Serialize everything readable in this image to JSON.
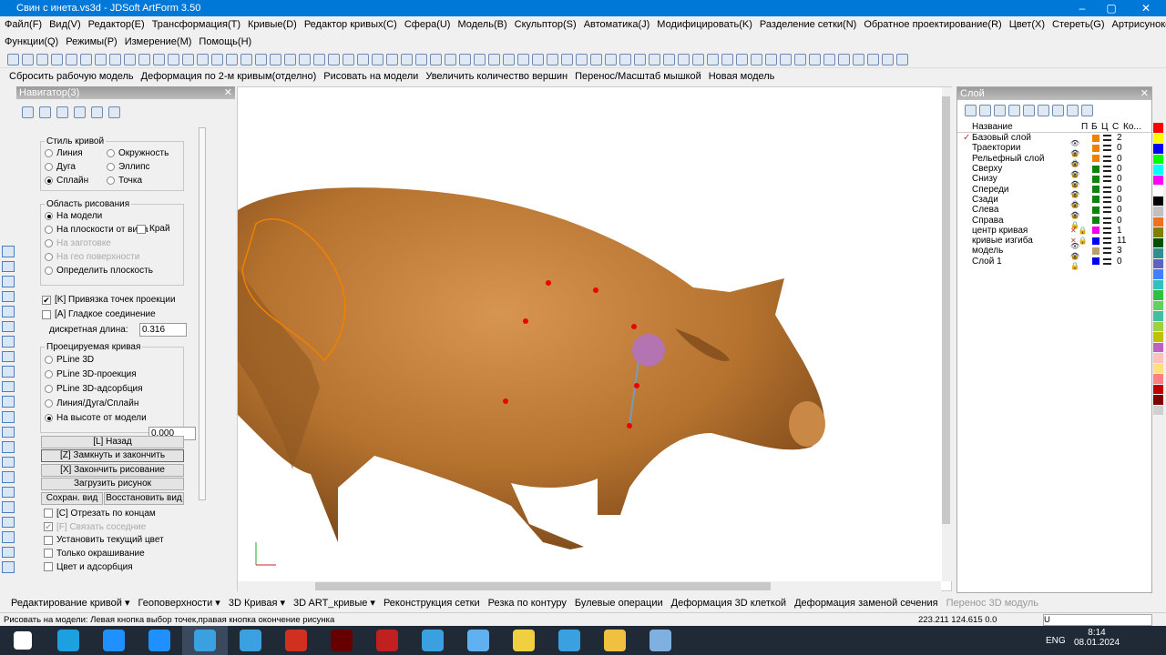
{
  "window": {
    "title": "Свин с инета.vs3d - JDSoft ArtForm 3.50",
    "min": "–",
    "max": "▢",
    "close": "✕"
  },
  "menu_row1": [
    "Файл(F)",
    "Вид(V)",
    "Редактор(E)",
    "Трансформация(T)",
    "Кривые(D)",
    "Редактор кривых(C)",
    "Сфера(U)",
    "Модель(B)",
    "Скульптор(S)",
    "Автоматика(J)",
    "Модифицировать(K)",
    "Разделение сетки(N)",
    "Обратное проектирование(R)",
    "Цвет(X)",
    "Стереть(G)",
    "Артрисунок(Y)"
  ],
  "menu_row2": [
    "Функции(Q)",
    "Режимы(P)",
    "Измерение(M)",
    "Помощь(H)"
  ],
  "text_toolbar": [
    "Сбросить рабочую модель",
    "Деформация по 2-м кривым(отделно)",
    "Рисовать на модели",
    "Увеличить количество вершин",
    "Перенос/Масштаб мышкой",
    "Новая модель"
  ],
  "navigator": {
    "title": "Навигатор(3)",
    "curve_style": {
      "label": "Стиль кривой",
      "options": [
        "Линия",
        "Окружность",
        "Дуга",
        "Эллипс",
        "Сплайн",
        "Точка"
      ],
      "selected": "Сплайн"
    },
    "draw_area": {
      "label": "Область рисования",
      "options": [
        "На модели",
        "На  плоскости от вида",
        "На заготовке",
        "На гео поверхности",
        "Определить плоскость"
      ],
      "selected": "На модели",
      "edge_label": "Край",
      "edge_checked": false
    },
    "snap_label": "[K] Привязка точек проекции",
    "snap_checked": true,
    "smooth_label": "[A] Гладкое соединение",
    "smooth_checked": false,
    "discrete_label": "дискретная длина:",
    "discrete_value": "0.316",
    "projected": {
      "label": "Проецируемая кривая",
      "options": [
        "PLine 3D",
        "PLine 3D-проекция",
        "PLine 3D-адсорбция",
        "Линия/Дуга/Сплайн",
        "На высоте от модели"
      ],
      "selected": "На высоте от модели",
      "height_value": "0.000"
    },
    "buttons": {
      "back": "[L] Назад",
      "close_finish": "[Z] Замкнуть и закончить",
      "finish": "[X] Закончить рисование",
      "load": "Загрузить рисунок",
      "save_view": "Сохран. вид",
      "restore_view": "Восстановить вид"
    },
    "checks": [
      {
        "label": "[C] Отрезать по концам",
        "checked": false,
        "disabled": false
      },
      {
        "label": "[F] Связать соседние",
        "checked": true,
        "disabled": true
      },
      {
        "label": "Установить текущий цвет",
        "checked": false,
        "disabled": false
      },
      {
        "label": "Только окрашивание",
        "checked": false,
        "disabled": false
      },
      {
        "label": "Цвет и адсорбция",
        "checked": false,
        "disabled": false
      }
    ]
  },
  "layers": {
    "title": "Слой",
    "columns": [
      "Название",
      "П",
      "Б",
      "Ц",
      "С",
      "Ко..."
    ],
    "rows": [
      {
        "name": "Базовый слой",
        "color": "#f08000",
        "count": "2",
        "visible": "none",
        "active": true
      },
      {
        "name": "Траектории",
        "color": "#f08000",
        "count": "0",
        "visible": "eye"
      },
      {
        "name": "Рельефный слой",
        "color": "#f08000",
        "count": "0",
        "visible": "eye"
      },
      {
        "name": "Сверху",
        "color": "#108010",
        "count": "0",
        "visible": "eye"
      },
      {
        "name": "Снизу",
        "color": "#108010",
        "count": "0",
        "visible": "eye"
      },
      {
        "name": "Спереди",
        "color": "#108010",
        "count": "0",
        "visible": "eye"
      },
      {
        "name": "Сзади",
        "color": "#108010",
        "count": "0",
        "visible": "eye"
      },
      {
        "name": "Слева",
        "color": "#108010",
        "count": "0",
        "visible": "eye"
      },
      {
        "name": "Справа",
        "color": "#108010",
        "count": "0",
        "visible": "eye"
      },
      {
        "name": "центр кривая",
        "color": "#f000f0",
        "count": "1",
        "visible": "hidden"
      },
      {
        "name": "кривые изгиба",
        "color": "#0000f0",
        "count": "11",
        "visible": "hidden"
      },
      {
        "name": "модель",
        "color": "#b8a070",
        "count": "3",
        "visible": "eye"
      },
      {
        "name": "Слой 1",
        "color": "#0000f0",
        "count": "0",
        "visible": "eye"
      }
    ]
  },
  "palette": [
    "#ff0000",
    "#ffff00",
    "#0000ff",
    "#00ff00",
    "#00ffff",
    "#ff00ff",
    "#ffffff",
    "#000000",
    "#c0c0c0",
    "#f07020",
    "#808000",
    "#005000",
    "#309090",
    "#6060c0",
    "#4080ff",
    "#30c0c0",
    "#30c040",
    "#60d060",
    "#40c0a0",
    "#a0d040",
    "#c0c000",
    "#c060c0",
    "#ffc0c0",
    "#ffe080",
    "#ff8080",
    "#c00000",
    "#800000",
    "#d0d0d0"
  ],
  "bottom_tabs": [
    "Редактирование кривой ▾",
    "Геоповерхности ▾",
    "3D Кривая ▾",
    "3D ART_кривые ▾",
    "Реконструкция сетки",
    "Резка по контуру",
    "Булевые операции",
    "Деформация 3D клеткой",
    "Деформация заменой сечения",
    "Перенос 3D модуль"
  ],
  "status": {
    "message": "Рисовать на модели: Левая кнопка выбор точек,правая кнопка окончение рисунка",
    "coords": "223.211 124.615 0.0",
    "field": "U"
  },
  "taskbar": {
    "lang": "ENG",
    "time": "8:14",
    "date": "08.01.2024",
    "apps": [
      "windows-start",
      "edge",
      "internet-explorer",
      "skype",
      "artform",
      "artform",
      "acrobat",
      "res",
      "app-red",
      "artform",
      "app-blue",
      "magic",
      "artform",
      "file-explorer",
      "paint"
    ]
  },
  "colors": {
    "titlebar": "#0078d7",
    "model": "#b5722e",
    "taskbar": "#202a36"
  }
}
